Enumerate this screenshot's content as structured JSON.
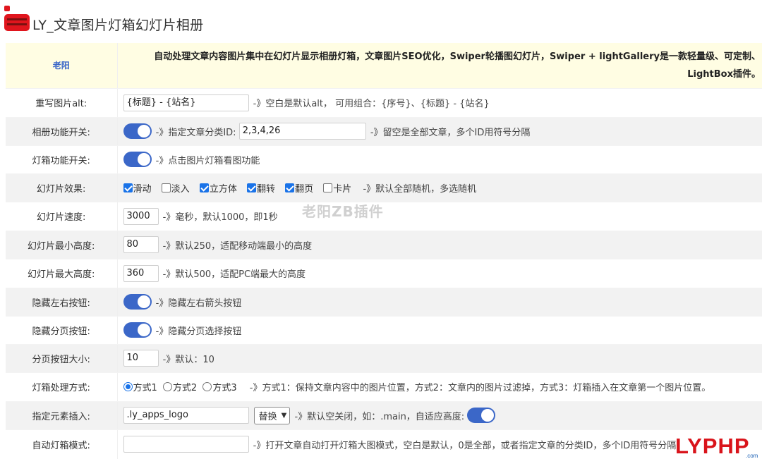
{
  "page": {
    "title": "LY_文章图片灯箱幻灯片相册"
  },
  "watermark": "老阳ZB插件",
  "brand": {
    "text": "LYPHP",
    "sub": ".com",
    "color": "#d9141b",
    "accent": "#1a5fb4"
  },
  "intro": {
    "label": "老阳",
    "text": "自动处理文章内容图片集中在幻灯片显示相册灯箱，文章图片SEO优化，Swiper轮播图幻灯片，Swiper + lightGallery是一款轻量级、可定制、 LightBox插件。"
  },
  "rows": {
    "alt": {
      "label": "重写图片alt:",
      "value": "{标题} - {站名}",
      "note": "-》空白是默认alt， 可用组合：{序号}、{标题} - {站名}"
    },
    "album": {
      "label": "相册功能开关:",
      "switch": true,
      "note_a": "-》指定文章分类ID:",
      "ids": "2,3,4,26",
      "note_b": "-》留空是全部文章，多个ID用符号分隔"
    },
    "lightbox": {
      "label": "灯箱功能开关:",
      "switch": true,
      "note": "-》点击图片灯箱看图功能"
    },
    "effect": {
      "label": "幻灯片效果:",
      "options": [
        {
          "label": "滑动",
          "checked": true
        },
        {
          "label": "淡入",
          "checked": false
        },
        {
          "label": "立方体",
          "checked": true
        },
        {
          "label": "翻转",
          "checked": true
        },
        {
          "label": "翻页",
          "checked": true
        },
        {
          "label": "卡片",
          "checked": false
        }
      ],
      "note": "-》默认全部随机，多选随机"
    },
    "speed": {
      "label": "幻灯片速度:",
      "value": "3000",
      "note": "-》毫秒，默认1000，即1秒"
    },
    "minh": {
      "label": "幻灯片最小高度:",
      "value": "80",
      "note": "-》默认250，适配移动端最小的高度"
    },
    "maxh": {
      "label": "幻灯片最大高度:",
      "value": "360",
      "note": "-》默认500，适配PC端最大的高度"
    },
    "arrows": {
      "label": "隐藏左右按钮:",
      "switch": true,
      "note": "-》隐藏左右箭头按钮"
    },
    "pager": {
      "label": "隐藏分页按钮:",
      "switch": true,
      "note": "-》隐藏分页选择按钮"
    },
    "pagersize": {
      "label": "分页按钮大小:",
      "value": "10",
      "note": "-》默认：10"
    },
    "mode": {
      "label": "灯箱处理方式:",
      "options": [
        {
          "label": "方式1",
          "checked": true
        },
        {
          "label": "方式2",
          "checked": false
        },
        {
          "label": "方式3",
          "checked": false
        }
      ],
      "note": "-》方式1：保持文章内容中的图片位置，方式2：文章内的图片过滤掉，方式3：灯箱插入在文章第一个图片位置。"
    },
    "insert": {
      "label": "指定元素插入:",
      "value": ".ly_apps_logo",
      "select": "替换",
      "note": "-》默认空关闭，如：.main，自适应高度:",
      "switch": true
    },
    "auto": {
      "label": "自动灯箱模式:",
      "value": "",
      "note": "-》打开文章自动打开灯箱大图模式，空白是默认，0是全部，或者指定文章的分类ID，多个ID用符号分隔"
    }
  }
}
